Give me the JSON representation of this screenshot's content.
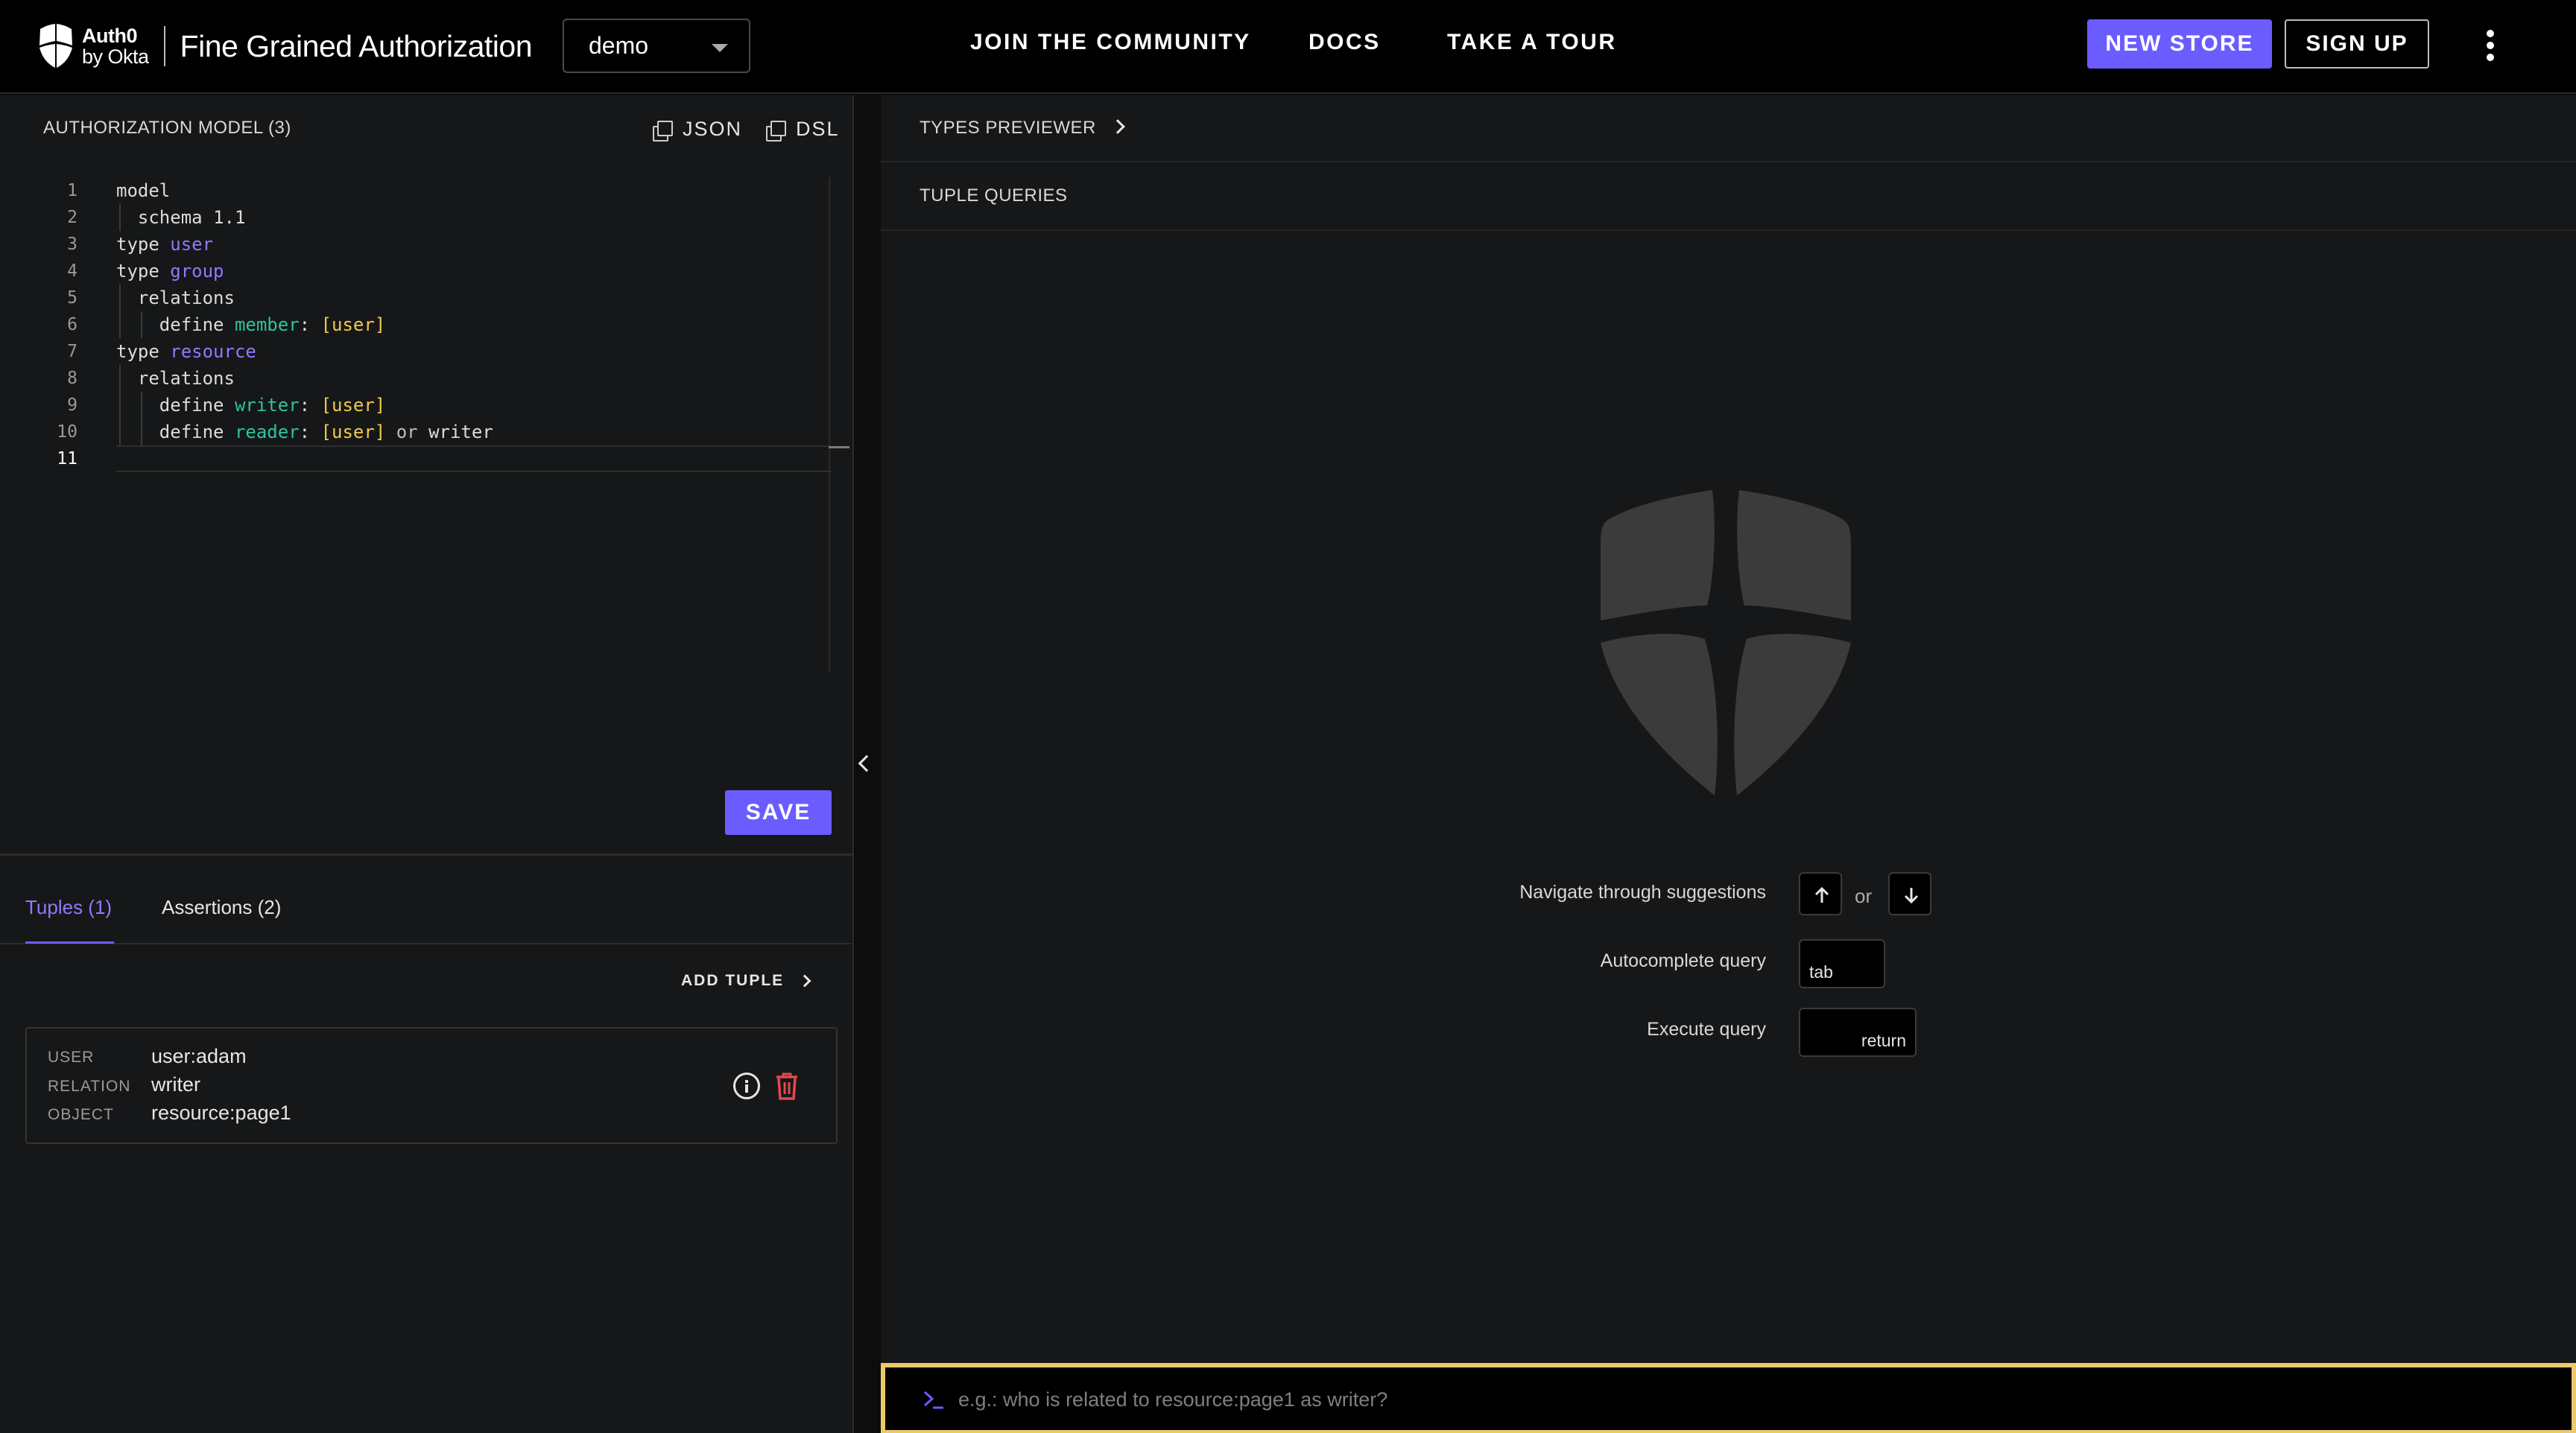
{
  "header": {
    "brand_line1": "Auth0",
    "brand_line2": "by Okta",
    "product": "Fine Grained Authorization",
    "store_selected": "demo",
    "nav": [
      "JOIN  THE COMMUNITY",
      "DOCS",
      "TAKE A  TOUR"
    ],
    "new_store": "NEW STORE",
    "sign_up": "SIGN UP",
    "accent_color": "#6b5cff"
  },
  "model_panel": {
    "title": "AUTHORIZATION MODEL (3)",
    "copy_json": "JSON",
    "copy_dsl": "DSL",
    "line_numbers": [
      "1",
      "2",
      "3",
      "4",
      "5",
      "6",
      "7",
      "8",
      "9",
      "10",
      "11"
    ],
    "code": {
      "l1": "model",
      "l2_kw": "schema",
      "l2_val": "1.1",
      "l3_kw": "type",
      "l3_name": "user",
      "l4_kw": "type",
      "l4_name": "group",
      "l5": "relations",
      "l6_kw": "define",
      "l6_rel": "member",
      "l6_type": "[user]",
      "l7_kw": "type",
      "l7_name": "resource",
      "l8": "relations",
      "l9_kw": "define",
      "l9_rel": "writer",
      "l9_type": "[user]",
      "l10_kw": "define",
      "l10_rel": "reader",
      "l10_type": "[user]",
      "l10_or": "or",
      "l10_ref": "writer"
    },
    "save": "SAVE"
  },
  "tabs": {
    "tuples": "Tuples (1)",
    "assertions": "Assertions (2)"
  },
  "tuples": {
    "add_tuple": "ADD TUPLE",
    "user_label": "USER",
    "relation_label": "RELATION",
    "object_label": "OBJECT",
    "items": [
      {
        "user": "user:adam",
        "relation": "writer",
        "object": "resource:page1"
      }
    ]
  },
  "right_panel": {
    "types_previewer": "TYPES PREVIEWER",
    "tuple_queries": "TUPLE QUERIES",
    "hints": {
      "navigate": "Navigate through suggestions",
      "or": "or",
      "autocomplete": "Autocomplete query",
      "autocomplete_key": "tab",
      "execute": "Execute query",
      "execute_key": "return"
    },
    "query_placeholder": "e.g.: who is related to resource:page1 as writer?",
    "query_border_color": "#ecc96a"
  }
}
